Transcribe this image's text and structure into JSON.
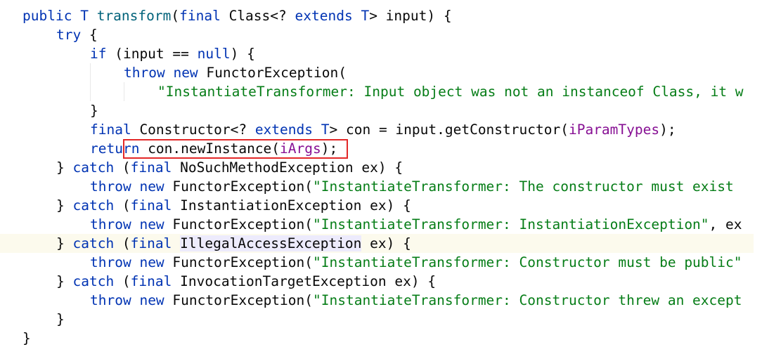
{
  "code": {
    "l1": [
      "public",
      " ",
      "T",
      " ",
      "transform",
      "(",
      "final",
      " Class<? ",
      "extends",
      " ",
      "T",
      "> input) {"
    ],
    "l2": [
      "try",
      " {"
    ],
    "l3": [
      "if",
      " (input == ",
      "null",
      ") {"
    ],
    "l4": [
      "throw",
      " ",
      "new",
      " FunctorException("
    ],
    "l5": [
      "\"InstantiateTransformer: Input object was not an instanceof Class, it w"
    ],
    "l6": [
      "}"
    ],
    "l7": [
      "final",
      " Constructor<? ",
      "extends",
      " ",
      "T",
      "> con = input.getConstructor(",
      "iParamTypes",
      ");"
    ],
    "l8": [
      "return",
      " con.newInstance(",
      "iArgs",
      ");"
    ],
    "l9": [
      "} ",
      "catch",
      " (",
      "final",
      " NoSuchMethodException ex) {"
    ],
    "l10": [
      "throw",
      " ",
      "new",
      " FunctorException(",
      "\"InstantiateTransformer: The constructor must exist"
    ],
    "l11": [
      "} ",
      "catch",
      " (",
      "final",
      " InstantiationException ex) {"
    ],
    "l12": [
      "throw",
      " ",
      "new",
      " FunctorException(",
      "\"InstantiateTransformer: InstantiationException\"",
      ", ex"
    ],
    "l13": [
      "} ",
      "catch",
      " (",
      "final",
      " ",
      "IllegalAccessException",
      " ex) {"
    ],
    "l14": [
      "throw",
      " ",
      "new",
      " FunctorException(",
      "\"InstantiateTransformer: Constructor must be public\""
    ],
    "l15": [
      "} ",
      "catch",
      " (",
      "final",
      " InvocationTargetException ex) {"
    ],
    "l16": [
      "throw",
      " ",
      "new",
      " FunctorException(",
      "\"InstantiateTransformer: Constructor threw an except"
    ],
    "l17": [
      "}"
    ],
    "l18": [
      "}"
    ]
  },
  "colors": {
    "keyword": "#0033b3",
    "string": "#067d17",
    "field": "#871094",
    "method": "#00627a",
    "current_line": "#fcfaed",
    "highlight_box": "#e32828"
  }
}
